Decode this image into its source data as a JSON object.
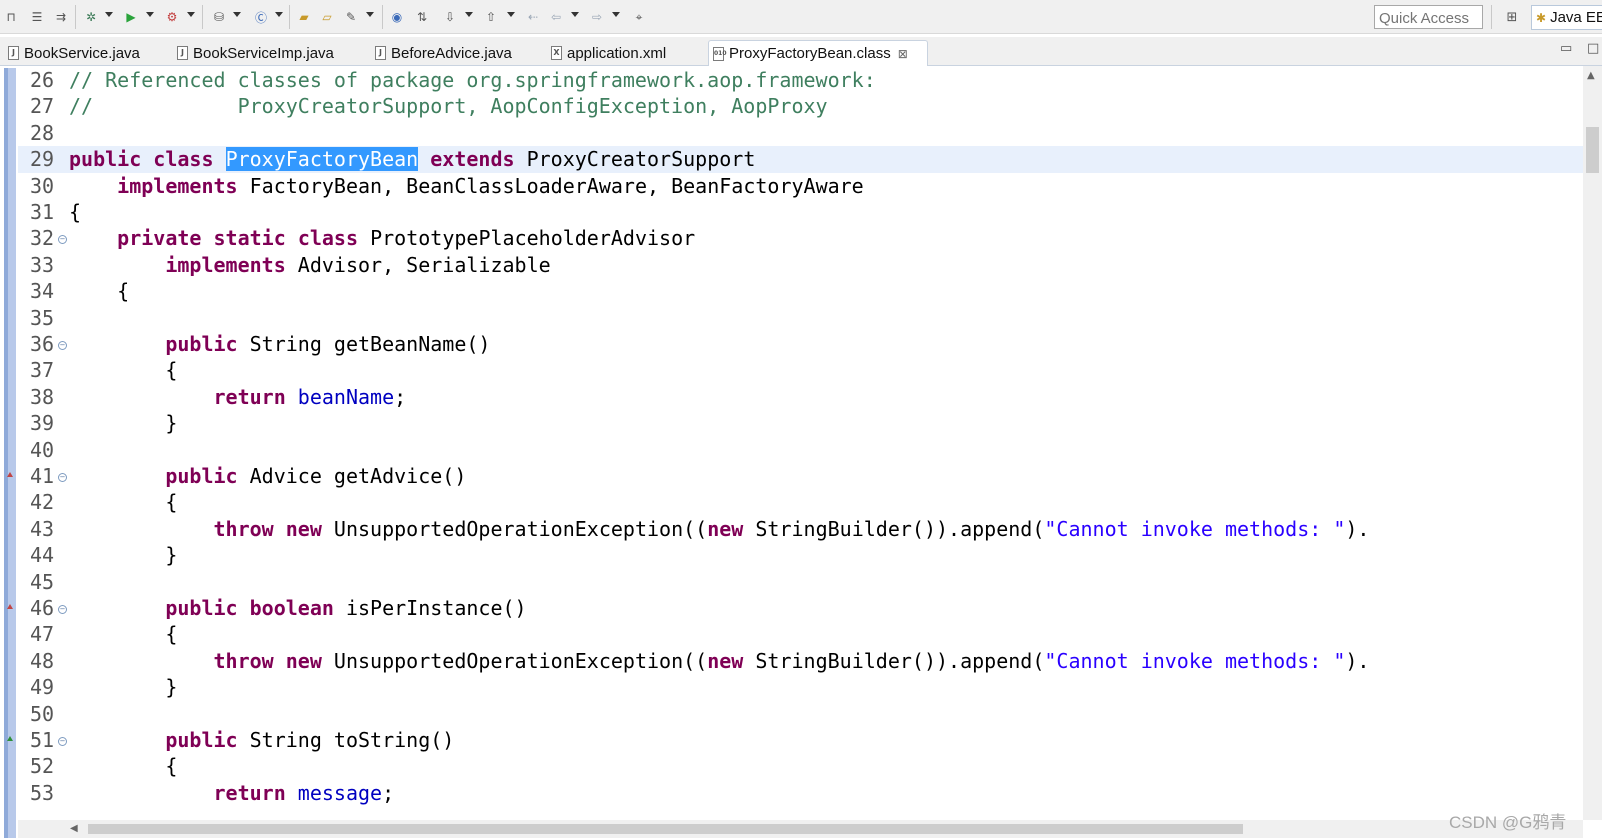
{
  "toolbar": {
    "quick_access_placeholder": "Quick Access",
    "perspective_label": "Java EE",
    "icons": [
      "save-icon",
      "debug-icon",
      "run-icon",
      "external-tools-icon",
      "new-server-icon",
      "new-class-icon",
      "open-type-icon",
      "search-icon",
      "web-browser-icon",
      "next-annotation-icon",
      "previous-annotation-icon",
      "back-icon",
      "forward-icon",
      "open-perspective-icon"
    ]
  },
  "tabs": [
    {
      "label": "BookService.java",
      "icon": "J"
    },
    {
      "label": "BookServiceImp.java",
      "icon": "J"
    },
    {
      "label": "BeforeAdvice.java",
      "icon": "J"
    },
    {
      "label": "application.xml",
      "icon": "X"
    },
    {
      "label": "ProxyFactoryBean.class",
      "icon": "010",
      "active": true,
      "close": "⊠"
    }
  ],
  "editor": {
    "lines": [
      {
        "n": "26",
        "segs": [
          {
            "t": "// Referenced classes of package org.springframework.aop.framework:",
            "c": "cm"
          }
        ]
      },
      {
        "n": "27",
        "segs": [
          {
            "t": "//            ProxyCreatorSupport, AopConfigException, AopProxy",
            "c": "cm"
          }
        ]
      },
      {
        "n": "28",
        "segs": []
      },
      {
        "n": "29",
        "current": true,
        "segs": [
          {
            "t": "public",
            "c": "kw"
          },
          {
            "t": " "
          },
          {
            "t": "class",
            "c": "kw"
          },
          {
            "t": " "
          },
          {
            "t": "ProxyFactoryBean",
            "c": "sel"
          },
          {
            "t": " "
          },
          {
            "t": "extends",
            "c": "kw"
          },
          {
            "t": " ProxyCreatorSupport"
          }
        ]
      },
      {
        "n": "30",
        "segs": [
          {
            "t": "    "
          },
          {
            "t": "implements",
            "c": "kw"
          },
          {
            "t": " FactoryBean, BeanClassLoaderAware, BeanFactoryAware"
          }
        ]
      },
      {
        "n": "31",
        "segs": [
          {
            "t": "{"
          }
        ]
      },
      {
        "n": "32",
        "fold": true,
        "segs": [
          {
            "t": "    "
          },
          {
            "t": "private",
            "c": "kw"
          },
          {
            "t": " "
          },
          {
            "t": "static",
            "c": "kw"
          },
          {
            "t": " "
          },
          {
            "t": "class",
            "c": "kw"
          },
          {
            "t": " PrototypePlaceholderAdvisor"
          }
        ]
      },
      {
        "n": "33",
        "segs": [
          {
            "t": "        "
          },
          {
            "t": "implements",
            "c": "kw"
          },
          {
            "t": " Advisor, Serializable"
          }
        ]
      },
      {
        "n": "34",
        "segs": [
          {
            "t": "    {"
          }
        ]
      },
      {
        "n": "35",
        "segs": []
      },
      {
        "n": "36",
        "fold": true,
        "segs": [
          {
            "t": "        "
          },
          {
            "t": "public",
            "c": "kw"
          },
          {
            "t": " String getBeanName()"
          }
        ]
      },
      {
        "n": "37",
        "segs": [
          {
            "t": "        {"
          }
        ]
      },
      {
        "n": "38",
        "segs": [
          {
            "t": "            "
          },
          {
            "t": "return",
            "c": "kw"
          },
          {
            "t": " "
          },
          {
            "t": "beanName",
            "c": "fld"
          },
          {
            "t": ";"
          }
        ]
      },
      {
        "n": "39",
        "segs": [
          {
            "t": "        }"
          }
        ]
      },
      {
        "n": "40",
        "segs": []
      },
      {
        "n": "41",
        "fold": true,
        "marker": "override",
        "segs": [
          {
            "t": "        "
          },
          {
            "t": "public",
            "c": "kw"
          },
          {
            "t": " Advice getAdvice()"
          }
        ]
      },
      {
        "n": "42",
        "segs": [
          {
            "t": "        {"
          }
        ]
      },
      {
        "n": "43",
        "segs": [
          {
            "t": "            "
          },
          {
            "t": "throw",
            "c": "kw"
          },
          {
            "t": " "
          },
          {
            "t": "new",
            "c": "kw"
          },
          {
            "t": " UnsupportedOperationException(("
          },
          {
            "t": "new",
            "c": "kw"
          },
          {
            "t": " StringBuilder()).append("
          },
          {
            "t": "\"Cannot invoke methods: \"",
            "c": "str"
          },
          {
            "t": ")."
          }
        ]
      },
      {
        "n": "44",
        "segs": [
          {
            "t": "        }"
          }
        ]
      },
      {
        "n": "45",
        "segs": []
      },
      {
        "n": "46",
        "fold": true,
        "marker": "override",
        "segs": [
          {
            "t": "        "
          },
          {
            "t": "public",
            "c": "kw"
          },
          {
            "t": " "
          },
          {
            "t": "boolean",
            "c": "kw"
          },
          {
            "t": " isPerInstance()"
          }
        ]
      },
      {
        "n": "47",
        "segs": [
          {
            "t": "        {"
          }
        ]
      },
      {
        "n": "48",
        "segs": [
          {
            "t": "            "
          },
          {
            "t": "throw",
            "c": "kw"
          },
          {
            "t": " "
          },
          {
            "t": "new",
            "c": "kw"
          },
          {
            "t": " UnsupportedOperationException(("
          },
          {
            "t": "new",
            "c": "kw"
          },
          {
            "t": " StringBuilder()).append("
          },
          {
            "t": "\"Cannot invoke methods: \"",
            "c": "str"
          },
          {
            "t": ")."
          }
        ]
      },
      {
        "n": "49",
        "segs": [
          {
            "t": "        }"
          }
        ]
      },
      {
        "n": "50",
        "segs": []
      },
      {
        "n": "51",
        "fold": true,
        "marker": "implement",
        "segs": [
          {
            "t": "        "
          },
          {
            "t": "public",
            "c": "kw"
          },
          {
            "t": " String toString()"
          }
        ]
      },
      {
        "n": "52",
        "segs": [
          {
            "t": "        {"
          }
        ]
      },
      {
        "n": "53",
        "segs": [
          {
            "t": "            "
          },
          {
            "t": "return",
            "c": "kw"
          },
          {
            "t": " "
          },
          {
            "t": "message",
            "c": "fld"
          },
          {
            "t": ";"
          }
        ]
      }
    ]
  },
  "watermark": "CSDN @G鸦青",
  "colors": {
    "keyword": "#7f0055",
    "comment": "#3f7f5f",
    "field": "#0000c0",
    "string": "#2a00ff",
    "selection": "#3399ff",
    "current_line": "#e8f0fc"
  }
}
